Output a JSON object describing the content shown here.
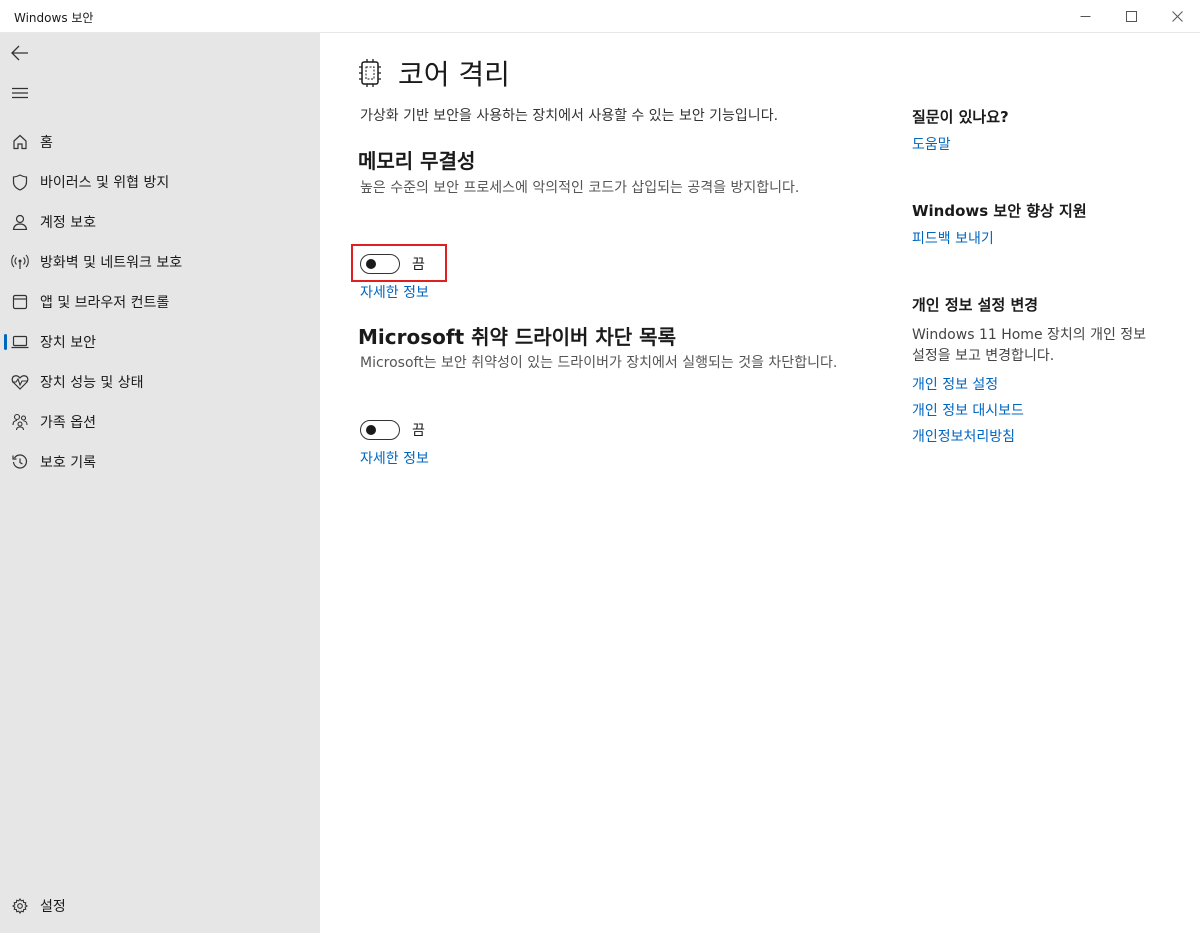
{
  "window": {
    "title": "Windows 보안"
  },
  "sidebar": {
    "items": [
      {
        "label": "홈",
        "icon": "home-icon"
      },
      {
        "label": "바이러스 및 위협 방지",
        "icon": "shield-icon"
      },
      {
        "label": "계정 보호",
        "icon": "person-icon"
      },
      {
        "label": "방화벽 및 네트워크 보호",
        "icon": "wifi-signal-icon"
      },
      {
        "label": "앱 및 브라우저 컨트롤",
        "icon": "browser-window-icon"
      },
      {
        "label": "장치 보안",
        "icon": "laptop-icon",
        "active": true
      },
      {
        "label": "장치 성능 및 상태",
        "icon": "heart-pulse-icon"
      },
      {
        "label": "가족 옵션",
        "icon": "family-icon"
      },
      {
        "label": "보호 기록",
        "icon": "history-icon"
      }
    ],
    "settings_label": "설정"
  },
  "main": {
    "title": "코어 격리",
    "description": "가상화 기반 보안을 사용하는 장치에서 사용할 수 있는 보안 기능입니다.",
    "memory_integrity": {
      "heading": "메모리 무결성",
      "description": "높은 수준의 보안 프로세스에 악의적인 코드가 삽입되는 공격을 방지합니다.",
      "toggle_state": "끔",
      "link": "자세한 정보"
    },
    "driver_blocklist": {
      "heading": "Microsoft 취약 드라이버 차단 목록",
      "description": "Microsoft는 보안 취약성이 있는 드라이버가 장치에서 실행되는 것을 차단합니다.",
      "toggle_state": "끔",
      "link": "자세한 정보"
    }
  },
  "right": {
    "questions_heading": "질문이 있나요?",
    "help_link": "도움말",
    "improve_heading": "Windows 보안 향상 지원",
    "feedback_link": "피드백 보내기",
    "privacy_heading": "개인 정보 설정 변경",
    "privacy_text": "Windows 11 Home 장치의 개인 정보 설정을 보고 변경합니다.",
    "privacy_settings_link": "개인 정보 설정",
    "privacy_dashboard_link": "개인 정보 대시보드",
    "privacy_statement_link": "개인정보처리방침"
  },
  "colors": {
    "accent": "#0067c0",
    "sidebar_bg": "#e6e6e6",
    "highlight": "#e02020"
  }
}
